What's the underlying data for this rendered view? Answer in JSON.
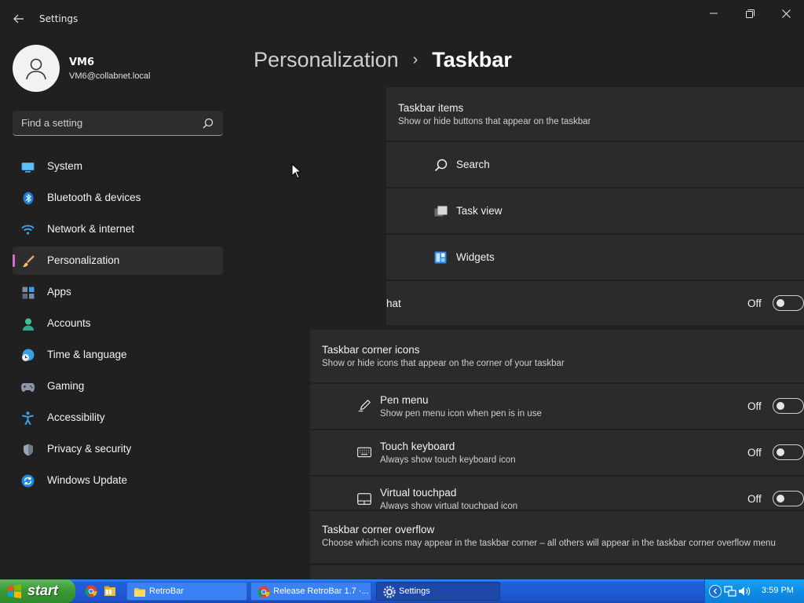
{
  "window": {
    "title": "Settings",
    "back_icon": "back-arrow-icon",
    "controls": [
      "minimize-icon",
      "maximize-icon",
      "close-icon"
    ]
  },
  "profile": {
    "name": "VM6",
    "email": "VM6@collabnet.local",
    "avatar_icon": "user-icon"
  },
  "search": {
    "placeholder": "Find a setting",
    "value": "",
    "icon": "search-icon"
  },
  "nav": {
    "selected": "Personalization",
    "items": [
      {
        "label": "System",
        "icon": "system-monitor-icon"
      },
      {
        "label": "Bluetooth & devices",
        "icon": "bluetooth-icon"
      },
      {
        "label": "Network & internet",
        "icon": "wifi-icon"
      },
      {
        "label": "Personalization",
        "icon": "paintbrush-icon"
      },
      {
        "label": "Apps",
        "icon": "apps-icon"
      },
      {
        "label": "Accounts",
        "icon": "account-icon"
      },
      {
        "label": "Time & language",
        "icon": "clock-globe-icon"
      },
      {
        "label": "Gaming",
        "icon": "gamepad-icon"
      },
      {
        "label": "Accessibility",
        "icon": "accessibility-icon"
      },
      {
        "label": "Privacy & security",
        "icon": "shield-icon"
      },
      {
        "label": "Windows Update",
        "icon": "update-icon"
      }
    ]
  },
  "breadcrumb": {
    "parent": "Personalization",
    "separator": "›",
    "current": "Taskbar"
  },
  "taskbar_items": {
    "title": "Taskbar items",
    "subtitle": "Show or hide buttons that appear on the taskbar",
    "rows": [
      {
        "label": "Search",
        "icon": "search-icon"
      },
      {
        "label": "Task view",
        "icon": "task-view-icon"
      },
      {
        "label": "Widgets",
        "icon": "widgets-icon"
      }
    ],
    "partial_row": {
      "label": "hat",
      "state": "Off"
    }
  },
  "corner_icons": {
    "title": "Taskbar corner icons",
    "subtitle": "Show or hide icons that appear on the corner of your taskbar",
    "rows": [
      {
        "label": "Pen menu",
        "sub": "Show pen menu icon when pen is in use",
        "state": "Off",
        "icon": "pen-icon"
      },
      {
        "label": "Touch keyboard",
        "sub": "Always show touch keyboard icon",
        "state": "Off",
        "icon": "keyboard-icon"
      },
      {
        "label": "Virtual touchpad",
        "sub": "Always show virtual touchpad icon",
        "state": "Off",
        "icon": "touchpad-icon"
      }
    ]
  },
  "corner_overflow": {
    "title": "Taskbar corner overflow",
    "subtitle": "Choose which icons may appear in the taskbar corner – all others will appear in the taskbar corner overflow menu"
  },
  "os_taskbar": {
    "start_label": "start",
    "quick_launch": [
      "chrome-icon",
      "file-explorer-icon"
    ],
    "tasks": [
      {
        "label": "RetroBar",
        "icon": "folder-icon",
        "active": false
      },
      {
        "label": "Release RetroBar 1.7 ·...",
        "icon": "chrome-icon",
        "active": false
      },
      {
        "label": "Settings",
        "icon": "gear-icon",
        "active": true
      }
    ],
    "tray_icons": [
      "chevron-left-icon",
      "network-icon",
      "volume-icon"
    ],
    "clock": "3:59 PM"
  },
  "colors": {
    "background": "#202020",
    "card": "#2b2b2b",
    "accent": "#d26bd8",
    "xp_taskbar": "#1f5bd4",
    "xp_start": "#3a9a36"
  }
}
